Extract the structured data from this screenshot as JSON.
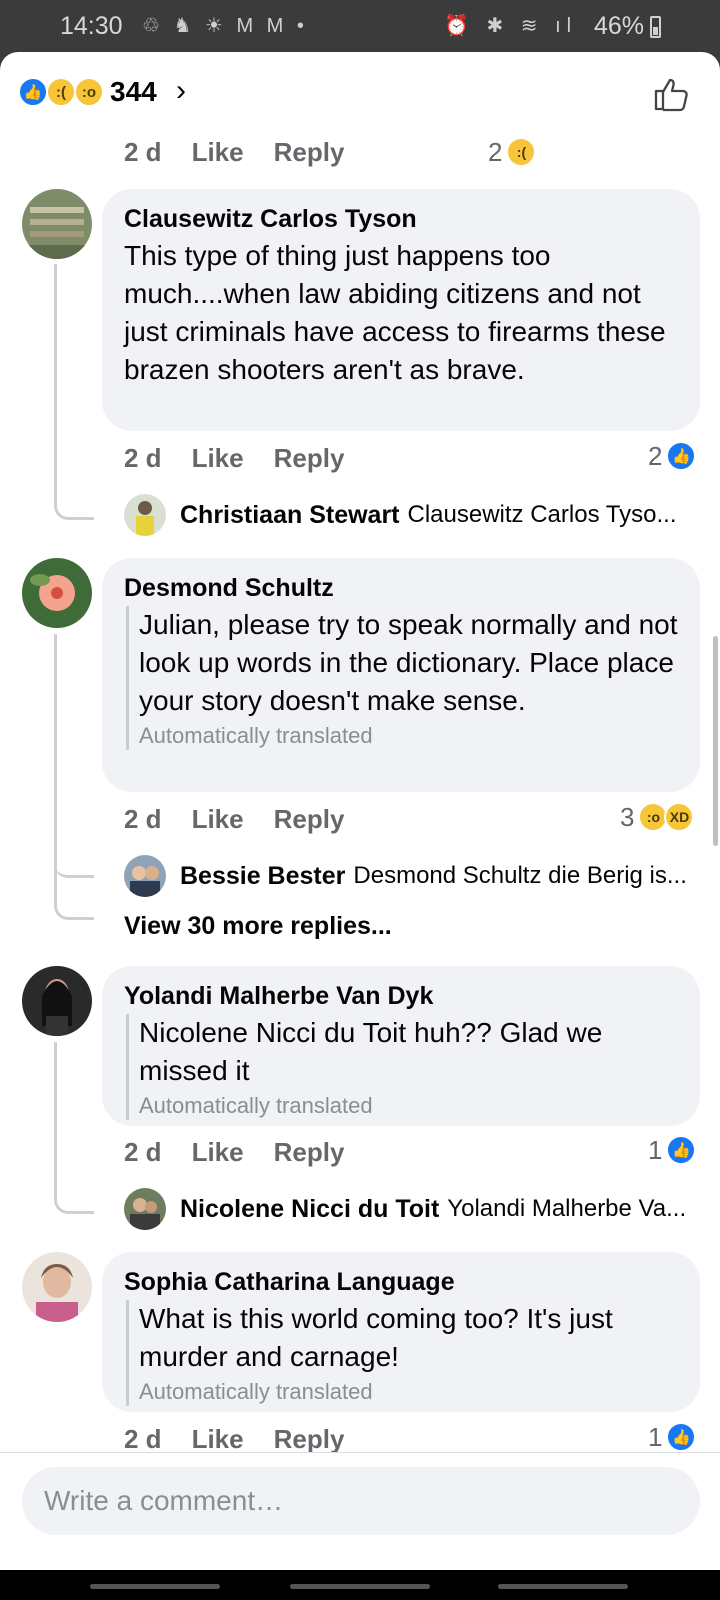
{
  "status_bar": {
    "time": "14:30",
    "left_icons": "♲ ♞ ☀ M M •",
    "right_icons": "⏰ ✱ ≋ ıl",
    "battery": "46%"
  },
  "header": {
    "reaction_count": "344",
    "chevron": "›"
  },
  "top_row": {
    "time": "2 d",
    "like": "Like",
    "reply": "Reply",
    "tally": "2"
  },
  "comments": [
    {
      "author": "Clausewitz Carlos Tyson",
      "text": "This type of thing just happens too much....when law abiding citizens and not just criminals have access to firearms these brazen shooters aren't as brave.",
      "time": "2 d",
      "like": "Like",
      "reply": "Reply",
      "tally": "2",
      "reply_preview": {
        "name": "Christiaan Stewart",
        "snippet": "Clausewitz Carlos Tyso..."
      }
    },
    {
      "author": "Desmond Schultz",
      "text": "Julian, please try to speak normally and not look up words in the dictionary. Place place your story doesn't make sense.",
      "auto_label": "Automatically translated",
      "time": "2 d",
      "like": "Like",
      "reply": "Reply",
      "tally": "3",
      "reply_preview": {
        "name": "Bessie Bester",
        "snippet": "Desmond Schultz die Berig is..."
      },
      "view_more": "View 30 more replies..."
    },
    {
      "author": "Yolandi Malherbe Van Dyk",
      "text": "Nicolene Nicci du Toit huh?? Glad we missed it",
      "auto_label": "Automatically translated",
      "time": "2 d",
      "like": "Like",
      "reply": "Reply",
      "tally": "1",
      "reply_preview": {
        "name": "Nicolene Nicci du Toit",
        "snippet": "Yolandi Malherbe Va..."
      }
    },
    {
      "author": "Sophia Catharina Language",
      "text": "What is this world coming too? It's just murder and carnage!",
      "auto_label": "Automatically translated",
      "time": "2 d",
      "like": "Like",
      "reply": "Reply",
      "tally": "1"
    }
  ],
  "composer": {
    "placeholder": "Write a comment…"
  },
  "colors": {
    "accent": "#1877f2",
    "bubble": "#f0f2f5",
    "meta": "#65676b"
  }
}
